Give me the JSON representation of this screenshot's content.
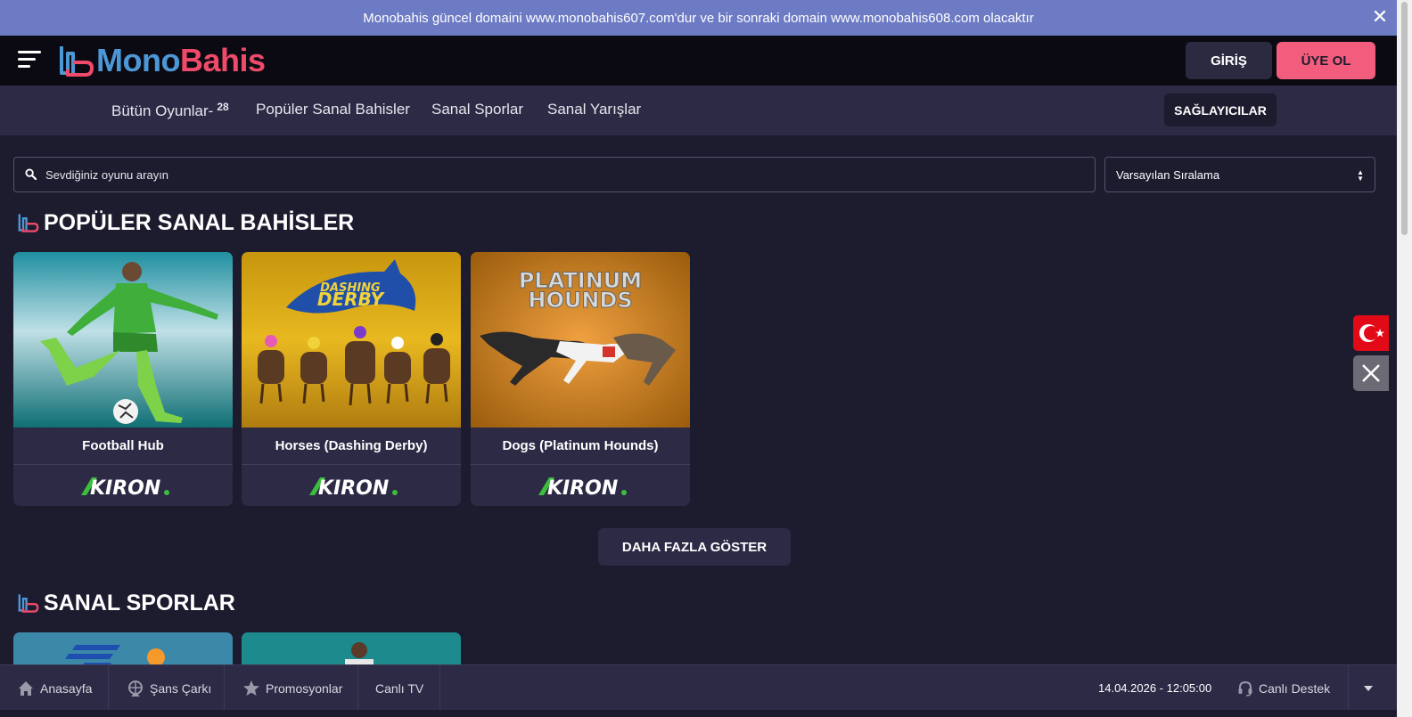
{
  "announcement": {
    "text": "Monobahis güncel domaini www.monobahis607.com'dur ve bir sonraki domain www.monobahis608.com olacaktır",
    "close_icon": "close-icon"
  },
  "header": {
    "logo_part1": "Mono",
    "logo_part2": "Bahis",
    "login_label": "GİRİŞ",
    "register_label": "ÜYE OL"
  },
  "subnav": {
    "items": [
      {
        "label": "Bütün Oyunlar-",
        "count": "28"
      },
      {
        "label": "Popüler Sanal Bahisler"
      },
      {
        "label": "Sanal Sporlar"
      },
      {
        "label": "Sanal Yarışlar"
      }
    ],
    "providers_label": "SAĞLAYICILAR"
  },
  "search": {
    "placeholder": "Sevdiğiniz oyunu arayın",
    "value": ""
  },
  "sort": {
    "selected": "Varsayılan Sıralama"
  },
  "sections": [
    {
      "title": "POPÜLER SANAL BAHİSLER",
      "games": [
        {
          "name": "Football Hub",
          "provider": "KIRON"
        },
        {
          "name": "Horses (Dashing Derby)",
          "provider": "KIRON",
          "thumb_text_1": "DASHING",
          "thumb_text_2": "DERBY"
        },
        {
          "name": "Dogs (Platinum Hounds)",
          "provider": "KIRON",
          "thumb_text_1": "PLATINUM",
          "thumb_text_2": "HOUNDS"
        }
      ],
      "more_label": "DAHA FAZLA GÖSTER"
    },
    {
      "title": "SANAL SPORLAR"
    }
  ],
  "bottom_bar": {
    "items": [
      {
        "label": "Anasayfa",
        "icon": "home-icon"
      },
      {
        "label": "Şans Çarkı",
        "icon": "wheel-icon"
      },
      {
        "label": "Promosyonlar",
        "icon": "star-icon"
      },
      {
        "label": "Canlı TV",
        "icon": ""
      }
    ],
    "datetime": "14.04.2026 - 12:05:00",
    "support_label": "Canlı Destek"
  },
  "colors": {
    "background": "#1d1b2e",
    "panel": "#2c2a45",
    "accent_pink": "#f35d7d",
    "accent_blue": "#4c97d6",
    "announce_bg": "#6d7bc4"
  }
}
